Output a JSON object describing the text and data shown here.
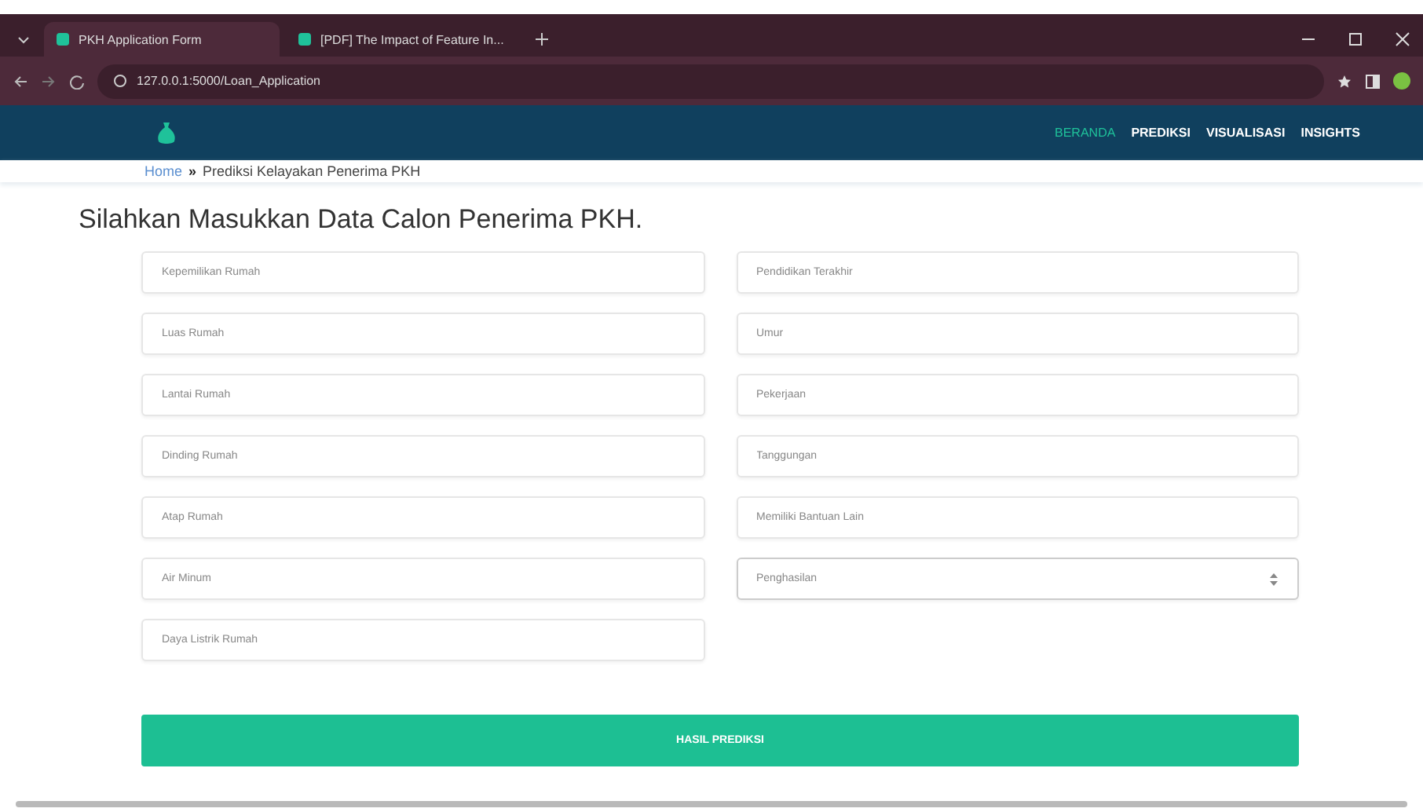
{
  "browser": {
    "tabs": [
      {
        "title": "PKH Application Form",
        "selected": true
      },
      {
        "title": "[PDF] The Impact of Feature In...",
        "selected": false
      }
    ],
    "address": "127.0.0.1:5000/Loan_Application"
  },
  "navbar": {
    "items": [
      {
        "label": "BERANDA",
        "selected": true
      },
      {
        "label": "PREDIKSI",
        "selected": false
      },
      {
        "label": "VISUALISASI",
        "selected": false
      },
      {
        "label": "INSIGHTS",
        "selected": false
      }
    ]
  },
  "breadcrumb": {
    "home": "Home",
    "separator": "»",
    "current": "Prediksi Kelayakan Penerima PKH"
  },
  "heading": "Silahkan Masukkan Data Calon Penerima PKH.",
  "form": {
    "left": [
      {
        "kind": "input",
        "placeholder": "Kepemilikan Rumah"
      },
      {
        "kind": "input",
        "placeholder": "Luas Rumah"
      },
      {
        "kind": "input",
        "placeholder": "Lantai Rumah"
      },
      {
        "kind": "input",
        "placeholder": "Dinding Rumah"
      },
      {
        "kind": "input",
        "placeholder": "Atap Rumah"
      },
      {
        "kind": "input",
        "placeholder": "Air Minum"
      },
      {
        "kind": "input",
        "placeholder": "Daya Listrik Rumah"
      }
    ],
    "right": [
      {
        "kind": "input",
        "placeholder": "Pendidikan Terakhir"
      },
      {
        "kind": "input",
        "placeholder": "Umur"
      },
      {
        "kind": "input",
        "placeholder": "Pekerjaan"
      },
      {
        "kind": "input",
        "placeholder": "Tanggungan"
      },
      {
        "kind": "input",
        "placeholder": "Memiliki Bantuan Lain"
      },
      {
        "kind": "number",
        "placeholder": "Penghasilan"
      }
    ],
    "submit": "HASIL PREDIKSI"
  }
}
